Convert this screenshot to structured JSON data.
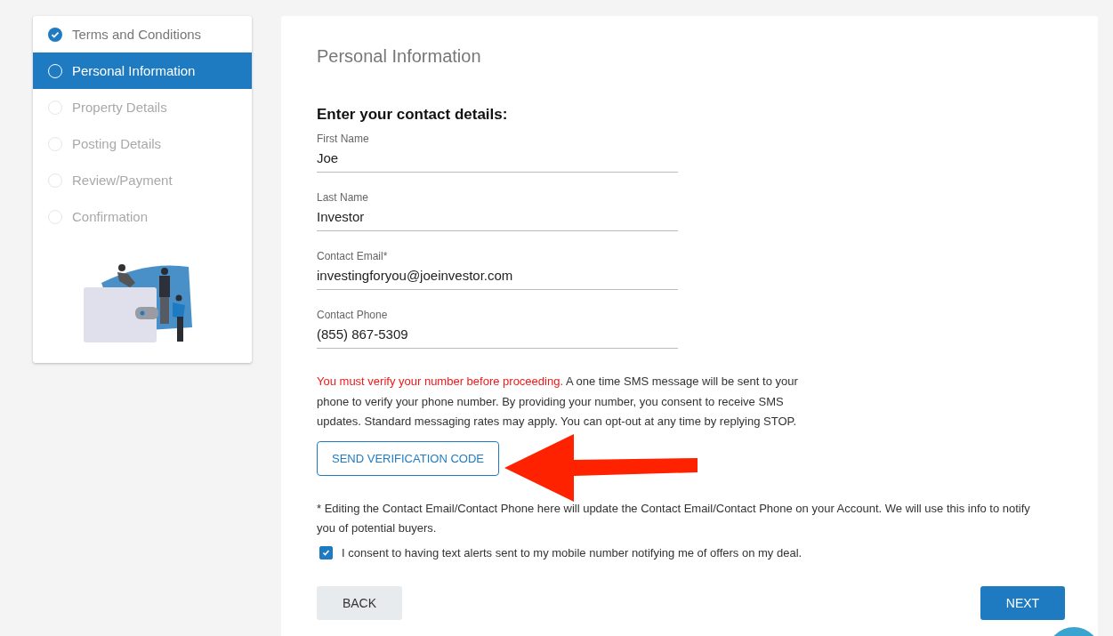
{
  "steps": [
    {
      "label": "Terms and Conditions",
      "completed": true,
      "disabled": false,
      "selected": false
    },
    {
      "label": "Personal Information",
      "completed": false,
      "disabled": false,
      "selected": true
    },
    {
      "label": "Property Details",
      "completed": false,
      "disabled": true,
      "selected": false
    },
    {
      "label": "Posting Details",
      "completed": false,
      "disabled": true,
      "selected": false
    },
    {
      "label": "Review/Payment",
      "completed": false,
      "disabled": true,
      "selected": false
    },
    {
      "label": "Confirmation",
      "completed": false,
      "disabled": true,
      "selected": false
    }
  ],
  "page_title": "Personal Information",
  "section_heading": "Enter your contact details:",
  "fields": [
    {
      "label": "First Name",
      "value": "Joe"
    },
    {
      "label": "Last Name",
      "value": "Investor"
    },
    {
      "label": "Contact Email*",
      "value": "investingforyou@joeinvestor.com"
    },
    {
      "label": "Contact Phone",
      "value": "(855) 867-5309"
    }
  ],
  "notice": {
    "warning": "You must verify your number before proceeding.",
    "text": "A one time SMS message will be sent to your phone to verify your phone number. By providing your number, you consent to receive SMS updates. Standard messaging rates may apply. You can opt-out at any time by replying STOP."
  },
  "verify_button": "SEND VERIFICATION CODE",
  "footnote": "* Editing the Contact Email/Contact Phone here will update the Contact Email/Contact Phone on your Account. We will use this info to notify you of potential buyers.",
  "consent": {
    "label": "I consent to having text alerts sent to my mobile number notifying me of offers on my deal.",
    "checked": true
  },
  "buttons": {
    "back": "BACK",
    "next": "NEXT"
  }
}
